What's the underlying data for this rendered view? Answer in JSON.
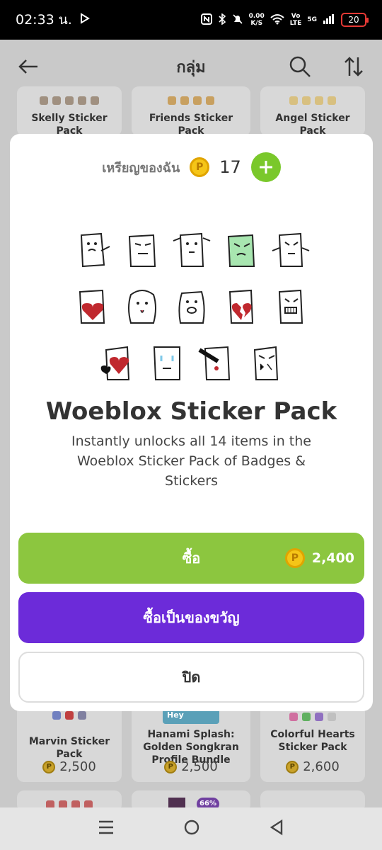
{
  "status_bar": {
    "time": "02:33 น.",
    "speed": "0.00",
    "speed_unit": "K/S",
    "network_vo": "Vo",
    "network_lte": "LTE",
    "network_5g": "5G",
    "battery": "20"
  },
  "app_bar": {
    "title": "กลุ่ม"
  },
  "cards_top": [
    {
      "name": "Skelly Sticker Pack"
    },
    {
      "name": "Friends Sticker Pack"
    },
    {
      "name": "Angel Sticker Pack"
    }
  ],
  "cards_bottom": [
    {
      "name": "Marvin Sticker Pack",
      "price": "2,500",
      "label_line2": ""
    },
    {
      "name": "Hanami Splash: Golden Songkran Profile Bundle",
      "price": "2,500",
      "badge": "Hey"
    },
    {
      "name": "Colorful Hearts Sticker Pack",
      "price": "2,600"
    }
  ],
  "cards_bottom_partial": {
    "badge": "66%"
  },
  "modal": {
    "wallet_label": "เหรียญของฉัน",
    "coin_symbol": "P",
    "wallet_count": "17",
    "pack_title": "Woeblox Sticker Pack",
    "pack_desc": "Instantly unlocks all 14 items in the Woeblox Sticker Pack of Badges & Stickers",
    "buy_label": "ซื้อ",
    "buy_price": "2,400",
    "gift_label": "ซื้อเป็นของขวัญ",
    "close_label": "ปิด"
  },
  "colors": {
    "accent_green": "#8cc63f",
    "accent_purple": "#6c2bd9",
    "coin": "#f5c518"
  },
  "icons": [
    "back-arrow-icon",
    "search-icon",
    "sort-icon",
    "plus-icon",
    "coin-icon",
    "menu-icon",
    "home-icon",
    "back-icon"
  ]
}
